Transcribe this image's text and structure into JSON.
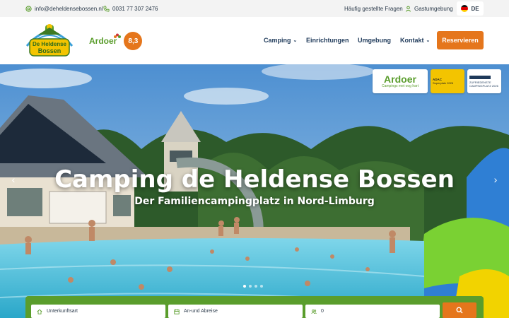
{
  "topbar": {
    "email": "info@deheldensebossen.nl",
    "phone": "0031 77 307 2476",
    "faq": "Häufig gestellte Fragen",
    "guest_account": "Gastumgebung",
    "language": "DE"
  },
  "header": {
    "logo_line1": "De Heldense",
    "logo_line2": "Bossen",
    "ardoer_label": "Ardoer",
    "rating": "8,3",
    "nav": [
      {
        "label": "Camping",
        "dropdown": true
      },
      {
        "label": "Einrichtungen",
        "dropdown": false
      },
      {
        "label": "Umgebung",
        "dropdown": false
      },
      {
        "label": "Kontakt",
        "dropdown": true
      }
    ],
    "reserve_label": "Reservieren"
  },
  "hero": {
    "title": "Camping de Heldense Bossen",
    "subtitle": "Der Familiencampingplatz in Nord-Limburg",
    "slides_total": 4,
    "slide_active": 1,
    "badges": {
      "ardoer_name": "Ardoer",
      "ardoer_tagline": "Campings met oog hart",
      "adac_title": "ADAC",
      "adac_text": "Superplatz 2026",
      "other_title": "ZUFRIEDENSTE CAMPINGPLATZ 2026"
    }
  },
  "booking": {
    "accommodation_placeholder": "Unterkunftsart",
    "dates_placeholder": "An-und Abreise",
    "guests_value": "0"
  },
  "colors": {
    "accent_orange": "#e5761c",
    "brand_green": "#5a9d2c",
    "nav_blue": "#1f3a5a"
  }
}
